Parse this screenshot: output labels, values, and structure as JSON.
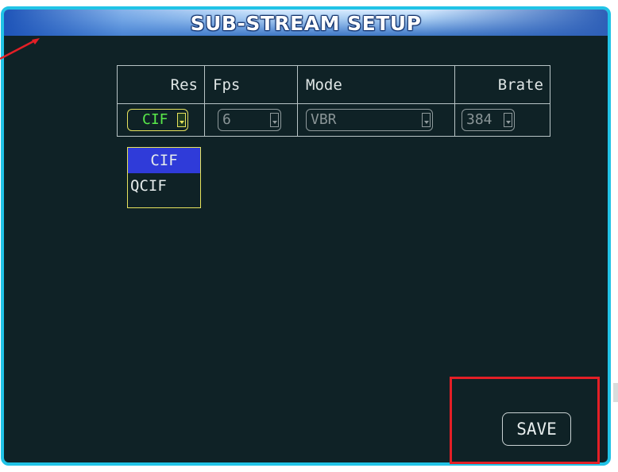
{
  "window": {
    "title": "SUB-STREAM SETUP"
  },
  "table": {
    "headers": {
      "res": "Res",
      "fps": "Fps",
      "mode": "Mode",
      "brate": "Brate"
    },
    "values": {
      "res": "CIF",
      "fps": "6",
      "mode": "VBR",
      "brate": "384"
    }
  },
  "res_dropdown": {
    "options": [
      "CIF",
      "QCIF"
    ],
    "selected": "CIF"
  },
  "footer": {
    "save_label": "SAVE"
  },
  "colors": {
    "background": "#0f2226",
    "frame": "#21c3e6",
    "focus_border": "#e7e35d",
    "active_text": "#59ea4a",
    "selection": "#2f3bd9",
    "annotation": "#e31f26"
  }
}
